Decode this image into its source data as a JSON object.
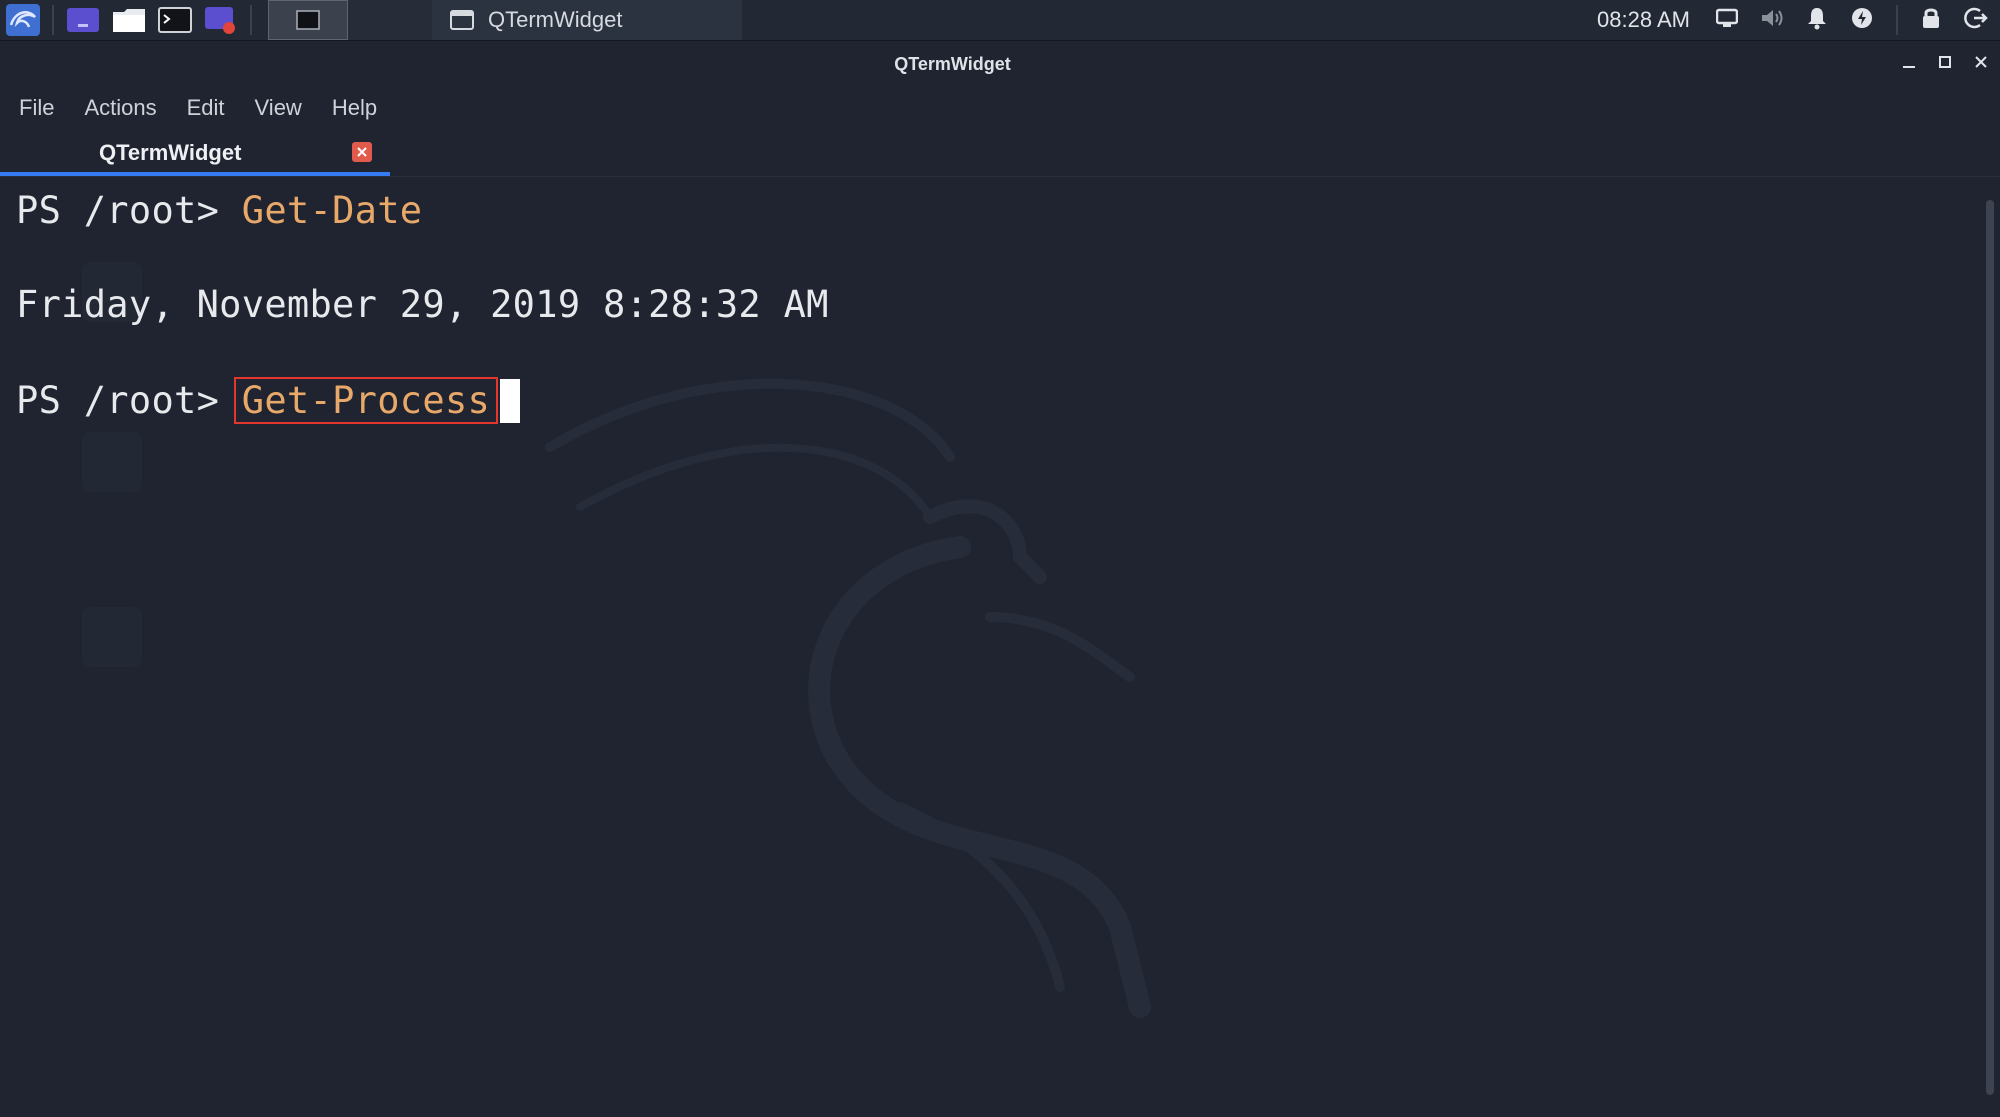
{
  "taskbar": {
    "launchers": [
      "kali-menu-icon",
      "desktop-icon",
      "file-manager-icon",
      "terminal-icon",
      "screen-recorder-icon"
    ],
    "task_title": "QTermWidget",
    "clock": "08:28 AM"
  },
  "window": {
    "title": "QTermWidget"
  },
  "menubar": {
    "items": [
      "File",
      "Actions",
      "Edit",
      "View",
      "Help"
    ]
  },
  "tabs": [
    {
      "label": "QTermWidget",
      "active": true
    }
  ],
  "terminal": {
    "prompt": "PS /root>",
    "line1_command": "Get-Date",
    "output": "Friday, November 29, 2019 8:28:32 AM",
    "line2_command": "Get-Process"
  },
  "colors": {
    "background": "#1f2430",
    "command": "#e8a86a",
    "highlight_box": "#e3362d",
    "tab_accent": "#367bf0"
  }
}
